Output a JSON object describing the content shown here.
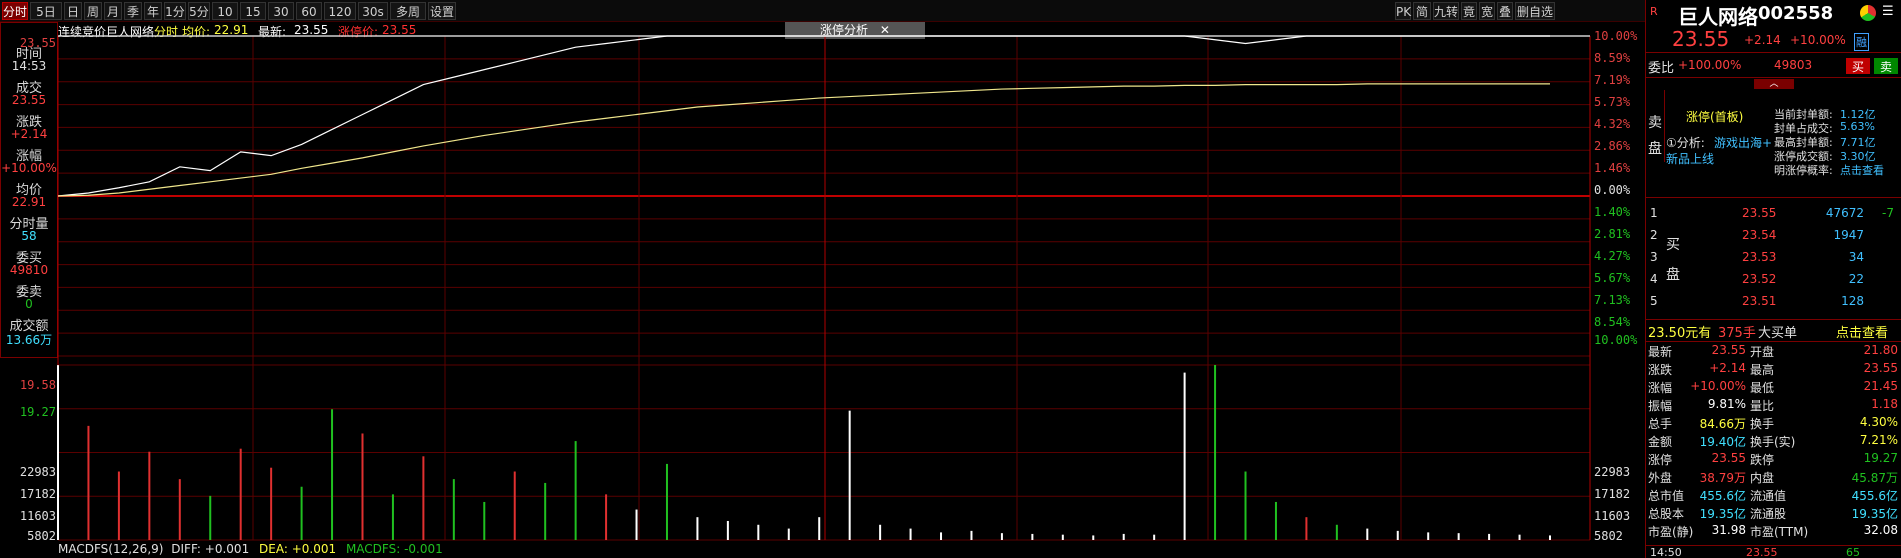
{
  "toolbar": {
    "tabs": [
      "分时",
      "5日",
      "日",
      "周",
      "月",
      "季",
      "年",
      "1分",
      "5分",
      "10分",
      "15分",
      "30分",
      "60分",
      "120分",
      "30s",
      "多周期",
      "设置"
    ],
    "right_buttons": [
      "PK",
      "简",
      "九转",
      "竟",
      "宽",
      "叠",
      "删自选"
    ]
  },
  "header": {
    "auction_label": "连续竞价",
    "stock_name": "巨人网络",
    "mode": "分时",
    "avg_label": "均价:",
    "avg_value": "22.91",
    "last_label": "最新:",
    "last_value": "23.55",
    "limit_label": "涨停价:",
    "limit_value": "23.55",
    "popup_label": "涨停分析",
    "popup_close": "✕"
  },
  "left_panel": {
    "time_label": "时间",
    "time_value": "14:53",
    "deal_label": "成交",
    "deal_value": "23.55",
    "change_label": "涨跌",
    "change_value": "+2.14",
    "pct_label": "涨幅",
    "pct_value": "+10.00%",
    "avg_label": "均价",
    "avg_value": "22.91",
    "vol_label": "分时量",
    "vol_value": "58",
    "bid_label": "委买",
    "bid_value": "49810",
    "ask_label": "委卖",
    "ask_value": "0",
    "amount_label": "成交额",
    "amount_value": "13.66万"
  },
  "price_axis_left": [
    "23.55",
    "19.58",
    "19.27"
  ],
  "price_axis_right": [
    {
      "text": "10.00%",
      "color": "#e04040"
    },
    {
      "text": "8.59%",
      "color": "#e04040"
    },
    {
      "text": "7.19%",
      "color": "#e04040"
    },
    {
      "text": "5.73%",
      "color": "#e04040"
    },
    {
      "text": "4.32%",
      "color": "#e04040"
    },
    {
      "text": "2.86%",
      "color": "#e04040"
    },
    {
      "text": "1.46%",
      "color": "#e04040"
    },
    {
      "text": "0.00%",
      "color": "#e0e0e0"
    },
    {
      "text": "1.40%",
      "color": "#20c020"
    },
    {
      "text": "2.81%",
      "color": "#20c020"
    },
    {
      "text": "4.27%",
      "color": "#20c020"
    },
    {
      "text": "5.67%",
      "color": "#20c020"
    },
    {
      "text": "7.13%",
      "color": "#20c020"
    },
    {
      "text": "8.54%",
      "color": "#20c020"
    },
    {
      "text": "10.00%",
      "color": "#20c020"
    }
  ],
  "volume_axis": [
    "22983",
    "17182",
    "11603",
    "5802"
  ],
  "macd": {
    "label": "MACDFS(12,26,9)",
    "diff": "DIFF: +0.001",
    "dea": "DEA: +0.001",
    "macdfs": "MACDFS: -0.001"
  },
  "chart_data": {
    "type": "line",
    "price_series": [
      21.41,
      21.45,
      21.52,
      21.6,
      21.8,
      21.75,
      22.0,
      21.95,
      22.1,
      22.3,
      22.5,
      22.7,
      22.9,
      23.0,
      23.1,
      23.2,
      23.3,
      23.4,
      23.45,
      23.5,
      23.55,
      23.55,
      23.55,
      23.55,
      23.55,
      23.55,
      23.55,
      23.55,
      23.55,
      23.55,
      23.55,
      23.55,
      23.55,
      23.55,
      23.55,
      23.55,
      23.55,
      23.55,
      23.5,
      23.45,
      23.5,
      23.55,
      23.55,
      23.55,
      23.55,
      23.55,
      23.55,
      23.55,
      23.55,
      23.55
    ],
    "avg_series": [
      21.41,
      21.42,
      21.45,
      21.5,
      21.55,
      21.6,
      21.65,
      21.7,
      21.78,
      21.85,
      21.92,
      22.0,
      22.08,
      22.15,
      22.22,
      22.28,
      22.34,
      22.4,
      22.45,
      22.5,
      22.55,
      22.6,
      22.63,
      22.66,
      22.69,
      22.72,
      22.74,
      22.76,
      22.78,
      22.8,
      22.82,
      22.84,
      22.85,
      22.86,
      22.87,
      22.88,
      22.88,
      22.89,
      22.89,
      22.9,
      22.9,
      22.9,
      22.9,
      22.91,
      22.91,
      22.91,
      22.91,
      22.91,
      22.91,
      22.91
    ],
    "ylim": [
      19.27,
      23.55
    ],
    "volume": [
      22983,
      15000,
      9000,
      11603,
      8000,
      5802,
      12000,
      9500,
      7000,
      17182,
      14000,
      6000,
      11000,
      8000,
      5000,
      9000,
      7500,
      13000,
      6000,
      4000,
      10000,
      3000,
      2500,
      2000,
      1500,
      3000,
      17000,
      2000,
      1500,
      1000,
      1200,
      900,
      800,
      700,
      600,
      800,
      700,
      22000,
      23000,
      9000,
      5000,
      3000,
      2000,
      1500,
      1200,
      1000,
      900,
      800,
      700,
      600
    ],
    "volume_colors": [
      "#fff",
      "#e03030",
      "#e03030",
      "#e03030",
      "#e03030",
      "#20c020",
      "#e03030",
      "#e03030",
      "#20c020",
      "#20c020",
      "#e03030",
      "#20c020",
      "#e03030",
      "#20c020",
      "#20c020",
      "#e03030",
      "#20c020",
      "#20c020",
      "#e03030",
      "#fff",
      "#20c020",
      "#fff",
      "#fff",
      "#fff",
      "#fff",
      "#fff",
      "#fff",
      "#fff",
      "#fff",
      "#fff",
      "#fff",
      "#fff",
      "#fff",
      "#fff",
      "#fff",
      "#fff",
      "#fff",
      "#fff",
      "#20c020",
      "#20c020",
      "#20c020",
      "#e03030",
      "#20c020",
      "#fff",
      "#fff",
      "#fff",
      "#fff",
      "#fff",
      "#fff",
      "#fff"
    ]
  },
  "right_panel": {
    "stock_name": "巨人网络",
    "stock_code": "002558",
    "price": "23.55",
    "change": "+2.14",
    "pct": "+10.00%",
    "margin_tag": "融",
    "commission_label": "委比",
    "commission_value": "+100.00%",
    "commission_diff": "49803",
    "buy_btn": "买",
    "sell_btn": "卖",
    "sell_side": "卖盘",
    "limit_title": "涨停(首板)",
    "analysis_label": "①分析:",
    "analysis_tag1": "游戏出海+",
    "analysis_tag2": "新品上线",
    "limit_stats": [
      {
        "label": "当前封单额:",
        "value": "1.12亿"
      },
      {
        "label": "封单占成交:",
        "value": "5.63%"
      },
      {
        "label": "最高封单额:",
        "value": "7.71亿"
      },
      {
        "label": "涨停成交额:",
        "value": "3.30亿"
      },
      {
        "label": "明涨停概率:",
        "value": "点击查看"
      }
    ],
    "buy_side": "买盘",
    "bids": [
      {
        "level": "1",
        "price": "23.55",
        "vol": "47672",
        "chg": "-7"
      },
      {
        "level": "2",
        "price": "23.54",
        "vol": "1947",
        "chg": ""
      },
      {
        "level": "3",
        "price": "23.53",
        "vol": "34",
        "chg": ""
      },
      {
        "level": "4",
        "price": "23.52",
        "vol": "22",
        "chg": ""
      },
      {
        "level": "5",
        "price": "23.51",
        "vol": "128",
        "chg": ""
      }
    ],
    "big_order_price": "23.50元有",
    "big_order_count": "375手",
    "big_order_label": "大买单",
    "big_order_link": "点击查看",
    "stats": [
      {
        "l1": "最新",
        "v1": "23.55",
        "c1": "#ff4040",
        "l2": "开盘",
        "v2": "21.80",
        "c2": "#ff4040"
      },
      {
        "l1": "涨跌",
        "v1": "+2.14",
        "c1": "#ff4040",
        "l2": "最高",
        "v2": "23.55",
        "c2": "#ff4040"
      },
      {
        "l1": "涨幅",
        "v1": "+10.00%",
        "c1": "#ff4040",
        "l2": "最低",
        "v2": "21.45",
        "c2": "#ff4040"
      },
      {
        "l1": "振幅",
        "v1": "9.81%",
        "c1": "#ffffff",
        "l2": "量比",
        "v2": "1.18",
        "c2": "#ff4040"
      },
      {
        "l1": "总手",
        "v1": "84.66万",
        "c1": "#ffff40",
        "l2": "换手",
        "v2": "4.30%",
        "c2": "#ffff40"
      },
      {
        "l1": "金额",
        "v1": "19.40亿",
        "c1": "#40e0ff",
        "l2": "换手(实)",
        "v2": "7.21%",
        "c2": "#ffff40"
      },
      {
        "l1": "涨停",
        "v1": "23.55",
        "c1": "#ff4040",
        "l2": "跌停",
        "v2": "19.27",
        "c2": "#20c020"
      },
      {
        "l1": "外盘",
        "v1": "38.79万",
        "c1": "#ff4040",
        "l2": "内盘",
        "v2": "45.87万",
        "c2": "#20c020"
      },
      {
        "l1": "总市值",
        "v1": "455.6亿",
        "c1": "#40e0ff",
        "l2": "流通值",
        "v2": "455.6亿",
        "c2": "#40e0ff"
      },
      {
        "l1": "总股本",
        "v1": "19.35亿",
        "c1": "#40e0ff",
        "l2": "流通股",
        "v2": "19.35亿",
        "c2": "#40e0ff"
      },
      {
        "l1": "市盈(静)",
        "v1": "31.98",
        "c1": "#ffffff",
        "l2": "市盈(TTM)",
        "v2": "32.08",
        "c2": "#ffffff"
      }
    ],
    "footer_time": "14:50",
    "footer_price": "23.55",
    "footer_vol": "65"
  }
}
